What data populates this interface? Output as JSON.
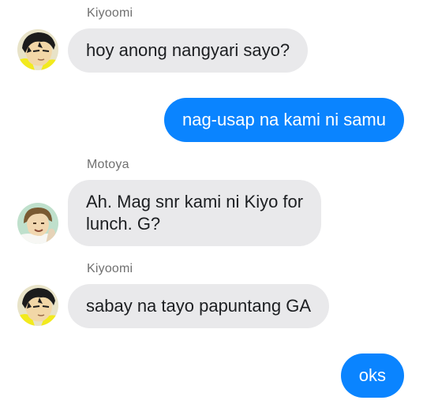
{
  "messages": [
    {
      "sender": "Kiyoomi",
      "text": "hoy anong nangyari sayo?",
      "avatar": "kiyoomi-avatar"
    },
    {
      "sender": "",
      "text": "nag-usap na kami ni samu",
      "direction": "outgoing"
    },
    {
      "sender": "Motoya",
      "text_line1": "Ah. Mag snr kami ni Kiyo for",
      "text_line2": "lunch. G?",
      "avatar": "motoya-avatar"
    },
    {
      "sender": "Kiyoomi",
      "text": "sabay na tayo papuntang GA",
      "avatar": "kiyoomi-avatar"
    },
    {
      "sender": "",
      "text": "oks",
      "direction": "outgoing"
    }
  ],
  "colors": {
    "incoming_bubble": "#e9e9eb",
    "outgoing_bubble": "#0a84ff",
    "sender_name": "#707070"
  }
}
